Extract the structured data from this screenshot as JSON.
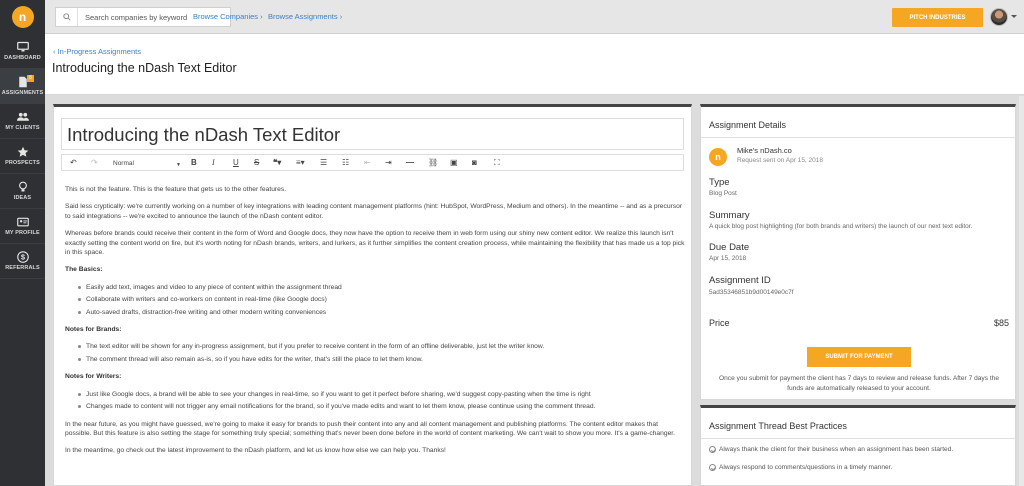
{
  "app": {
    "logo_text": "n"
  },
  "sidebar": {
    "items": [
      {
        "label": "DASHBOARD",
        "icon": "monitor-icon"
      },
      {
        "label": "ASSIGNMENTS",
        "icon": "document-icon",
        "badge": "8"
      },
      {
        "label": "MY CLIENTS",
        "icon": "people-icon"
      },
      {
        "label": "PROSPECTS",
        "icon": "star-icon"
      },
      {
        "label": "IDEAS",
        "icon": "lightbulb-icon"
      },
      {
        "label": "MY PROFILE",
        "icon": "profile-card-icon"
      },
      {
        "label": "REFERRALS",
        "icon": "dollar-icon"
      }
    ]
  },
  "topbar": {
    "search_placeholder": "Search companies by keyword",
    "browse_companies": "Browse Companies ›",
    "browse_assignments": "Browse Assignments ›",
    "pitch_button": "PITCH INDUSTRIES"
  },
  "header": {
    "breadcrumb": "‹ In-Progress Assignments",
    "title": "Introducing the nDash Text Editor"
  },
  "editor": {
    "title": "Introducing the nDash Text Editor",
    "format_select": "Normal",
    "content": {
      "p1": "This is not the feature. This is the feature that gets us to the other features.",
      "p2": "Said less cryptically:  we're currently working on a number of key integrations with leading content management platforms (hint: HubSpot, WordPress, Medium and others). In the meantime -- and as a precursor to said integrations -- we're excited to announce the launch of the nDash content editor.",
      "p3": "Whereas before brands could receive their content in the form of Word and Google docs, they now have the option to receive them in web form using our shiny new content editor. We realize this launch isn't exactly setting the content world on fire, but it's worth noting for nDash brands, writers, and lurkers, as it further simplifies the content creation process, while maintaining the flexibility that has made us a top pick in this space.",
      "basics_heading": "The Basics:",
      "basics": [
        "Easily add text, images and video to any piece of content within the assignment thread",
        "Collaborate with writers and co-workers on content  in real-time (like Google docs)",
        "Auto-saved drafts, distraction-free writing and other modern writing conveniences"
      ],
      "brands_heading": "Notes for Brands:",
      "brands": [
        "The text editor will be shown for any in-progress assignment, but if you prefer to receive content in the form of an offline deliverable, just let the writer know.",
        "The comment thread will also remain as-is, so if you have edits for the writer, that's still the place to let them know."
      ],
      "writers_heading": "Notes for Writers:",
      "writers": [
        "Just like Google docs, a brand will be able to see your changes in real-time, so if you want to get it perfect before sharing, we'd suggest copy-pasting when the time is right",
        "Changes made to content will not trigger any email notifications for the brand, so if you've made edits and want to let them know, please continue using the comment thread."
      ],
      "p4": "In the near future, as you might have guessed, we're going to make it easy for brands to push their content into any and all content management and publishing platforms. The content editor makes that possible. But this feature is also setting the stage for something truly special; something that's never been done before in the world of content marketing. We can't wait to show you more. It's a game-changer.",
      "p5": "In the meantime, go check out the latest improvement to the nDash platform, and let us know how else we can help you. Thanks!"
    }
  },
  "details": {
    "title": "Assignment Details",
    "client_icon_text": "n",
    "client_name": "Mike's nDash.co",
    "request_sent": "Request sent on Apr 15, 2018",
    "type_label": "Type",
    "type_value": "Blog Post",
    "summary_label": "Summary",
    "summary_value": "A quick blog post highlighting (for both brands and writers) the launch of our next text editor.",
    "due_label": "Due Date",
    "due_value": "Apr 15, 2018",
    "id_label": "Assignment ID",
    "id_value": "5ad35346851b9d00149e0c7f",
    "price_label": "Price",
    "price_value": "$85",
    "submit_button": "SUBMIT FOR PAYMENT",
    "payment_note": "Once you submit for payment the client has 7 days to review and release funds. After 7 days the funds are automatically released to your account."
  },
  "best_practices": {
    "title": "Assignment Thread Best Practices",
    "items": [
      "Always thank the client for their business when an assignment has been started.",
      "Always respond to comments/questions in a timely manner."
    ]
  }
}
